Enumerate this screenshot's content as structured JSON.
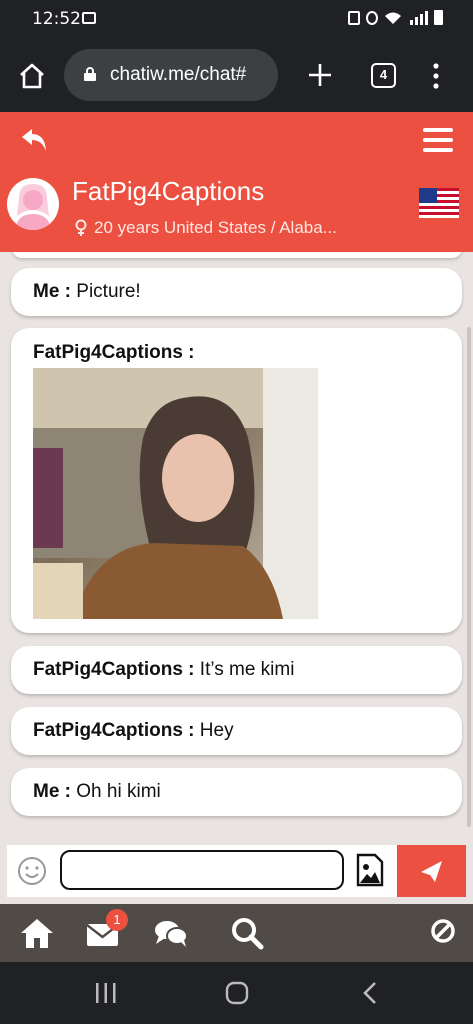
{
  "status_bar": {
    "time": "12:52",
    "indicators": [
      "gallery-icon",
      "lock-icon",
      "alarm-icon",
      "wifi-icon",
      "lte-signal-icon",
      "battery-icon"
    ]
  },
  "browser": {
    "url": "chatiw.me/chat#",
    "tab_count": "4"
  },
  "header": {
    "username": "FatPig4Captions",
    "info": "20 years United States / Alaba...",
    "gender": "female",
    "country_flag": "us-flag-icon",
    "accent_color": "#ec5040"
  },
  "messages": [
    {
      "sender": "Me :",
      "text": " Picture!"
    },
    {
      "sender": "FatPig4Captions :",
      "text": "",
      "has_image": true
    },
    {
      "sender": "FatPig4Captions :",
      "text": " It’s me kimi"
    },
    {
      "sender": "FatPig4Captions :",
      "text": " Hey"
    },
    {
      "sender": "Me :",
      "text": " Oh hi kimi"
    }
  ],
  "composer": {
    "value": ""
  },
  "bottom_nav": {
    "inbox_badge": "1"
  }
}
